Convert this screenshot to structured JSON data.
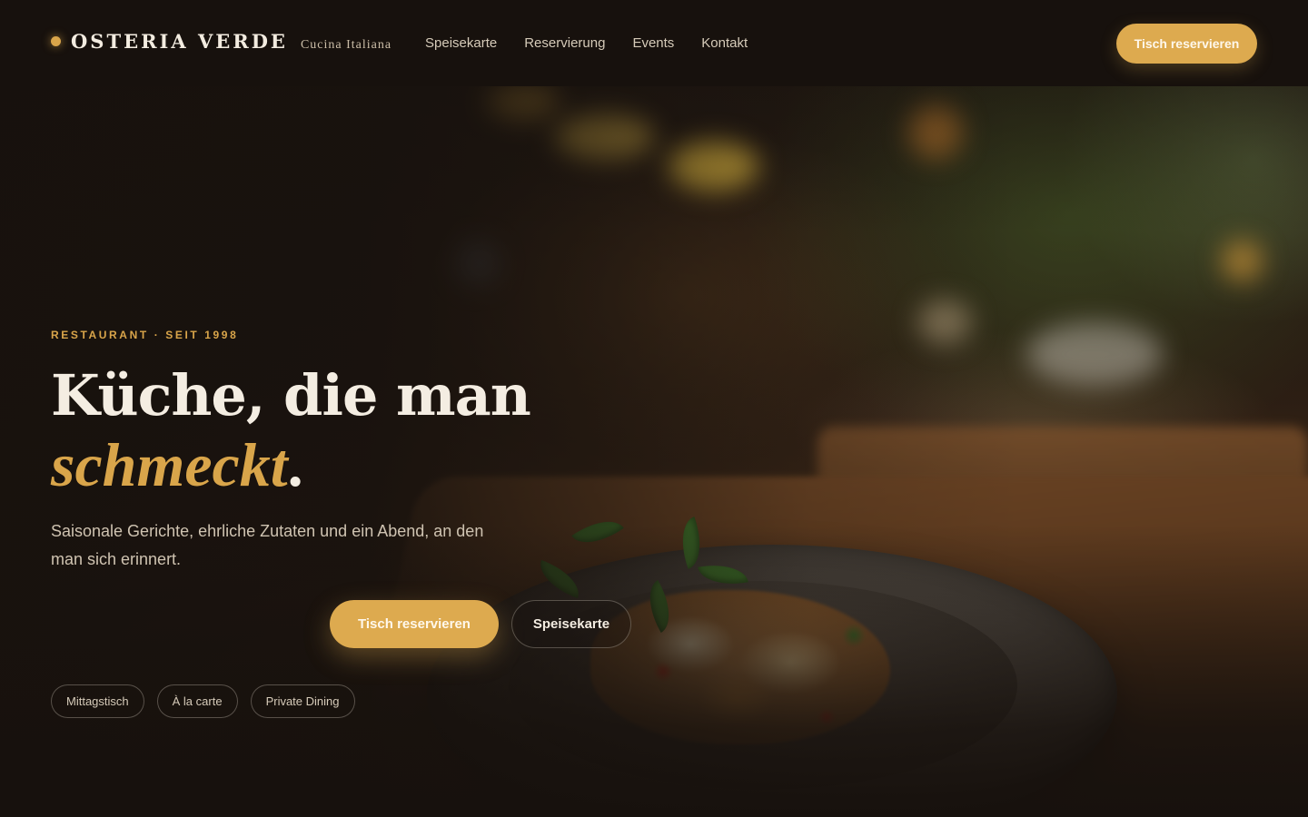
{
  "brand": {
    "name": "OSTERIA VERDE",
    "tagline": "Cucina Italiana"
  },
  "nav": {
    "items": [
      {
        "label": "Speisekarte"
      },
      {
        "label": "Reservierung"
      },
      {
        "label": "Events"
      },
      {
        "label": "Kontakt"
      }
    ],
    "cta_label": "Tisch reservieren"
  },
  "hero": {
    "eyebrow": "RESTAURANT · SEIT 1998",
    "headline_line1": "Küche, die man",
    "headline_accent": "schmeckt",
    "headline_end": ".",
    "lead": "Saisonale Gerichte, ehrliche Zutaten und ein Abend, an den man sich erinnert.",
    "primary_label": "Tisch reservieren",
    "secondary_label": "Speisekarte",
    "chips": [
      {
        "label": "Mittagstisch"
      },
      {
        "label": "À la carte"
      },
      {
        "label": "Private Dining"
      }
    ]
  },
  "colors": {
    "background": "#17110d",
    "accent": "#ddaa4f",
    "text": "#f4ede2",
    "muted": "#cfc3b1"
  }
}
